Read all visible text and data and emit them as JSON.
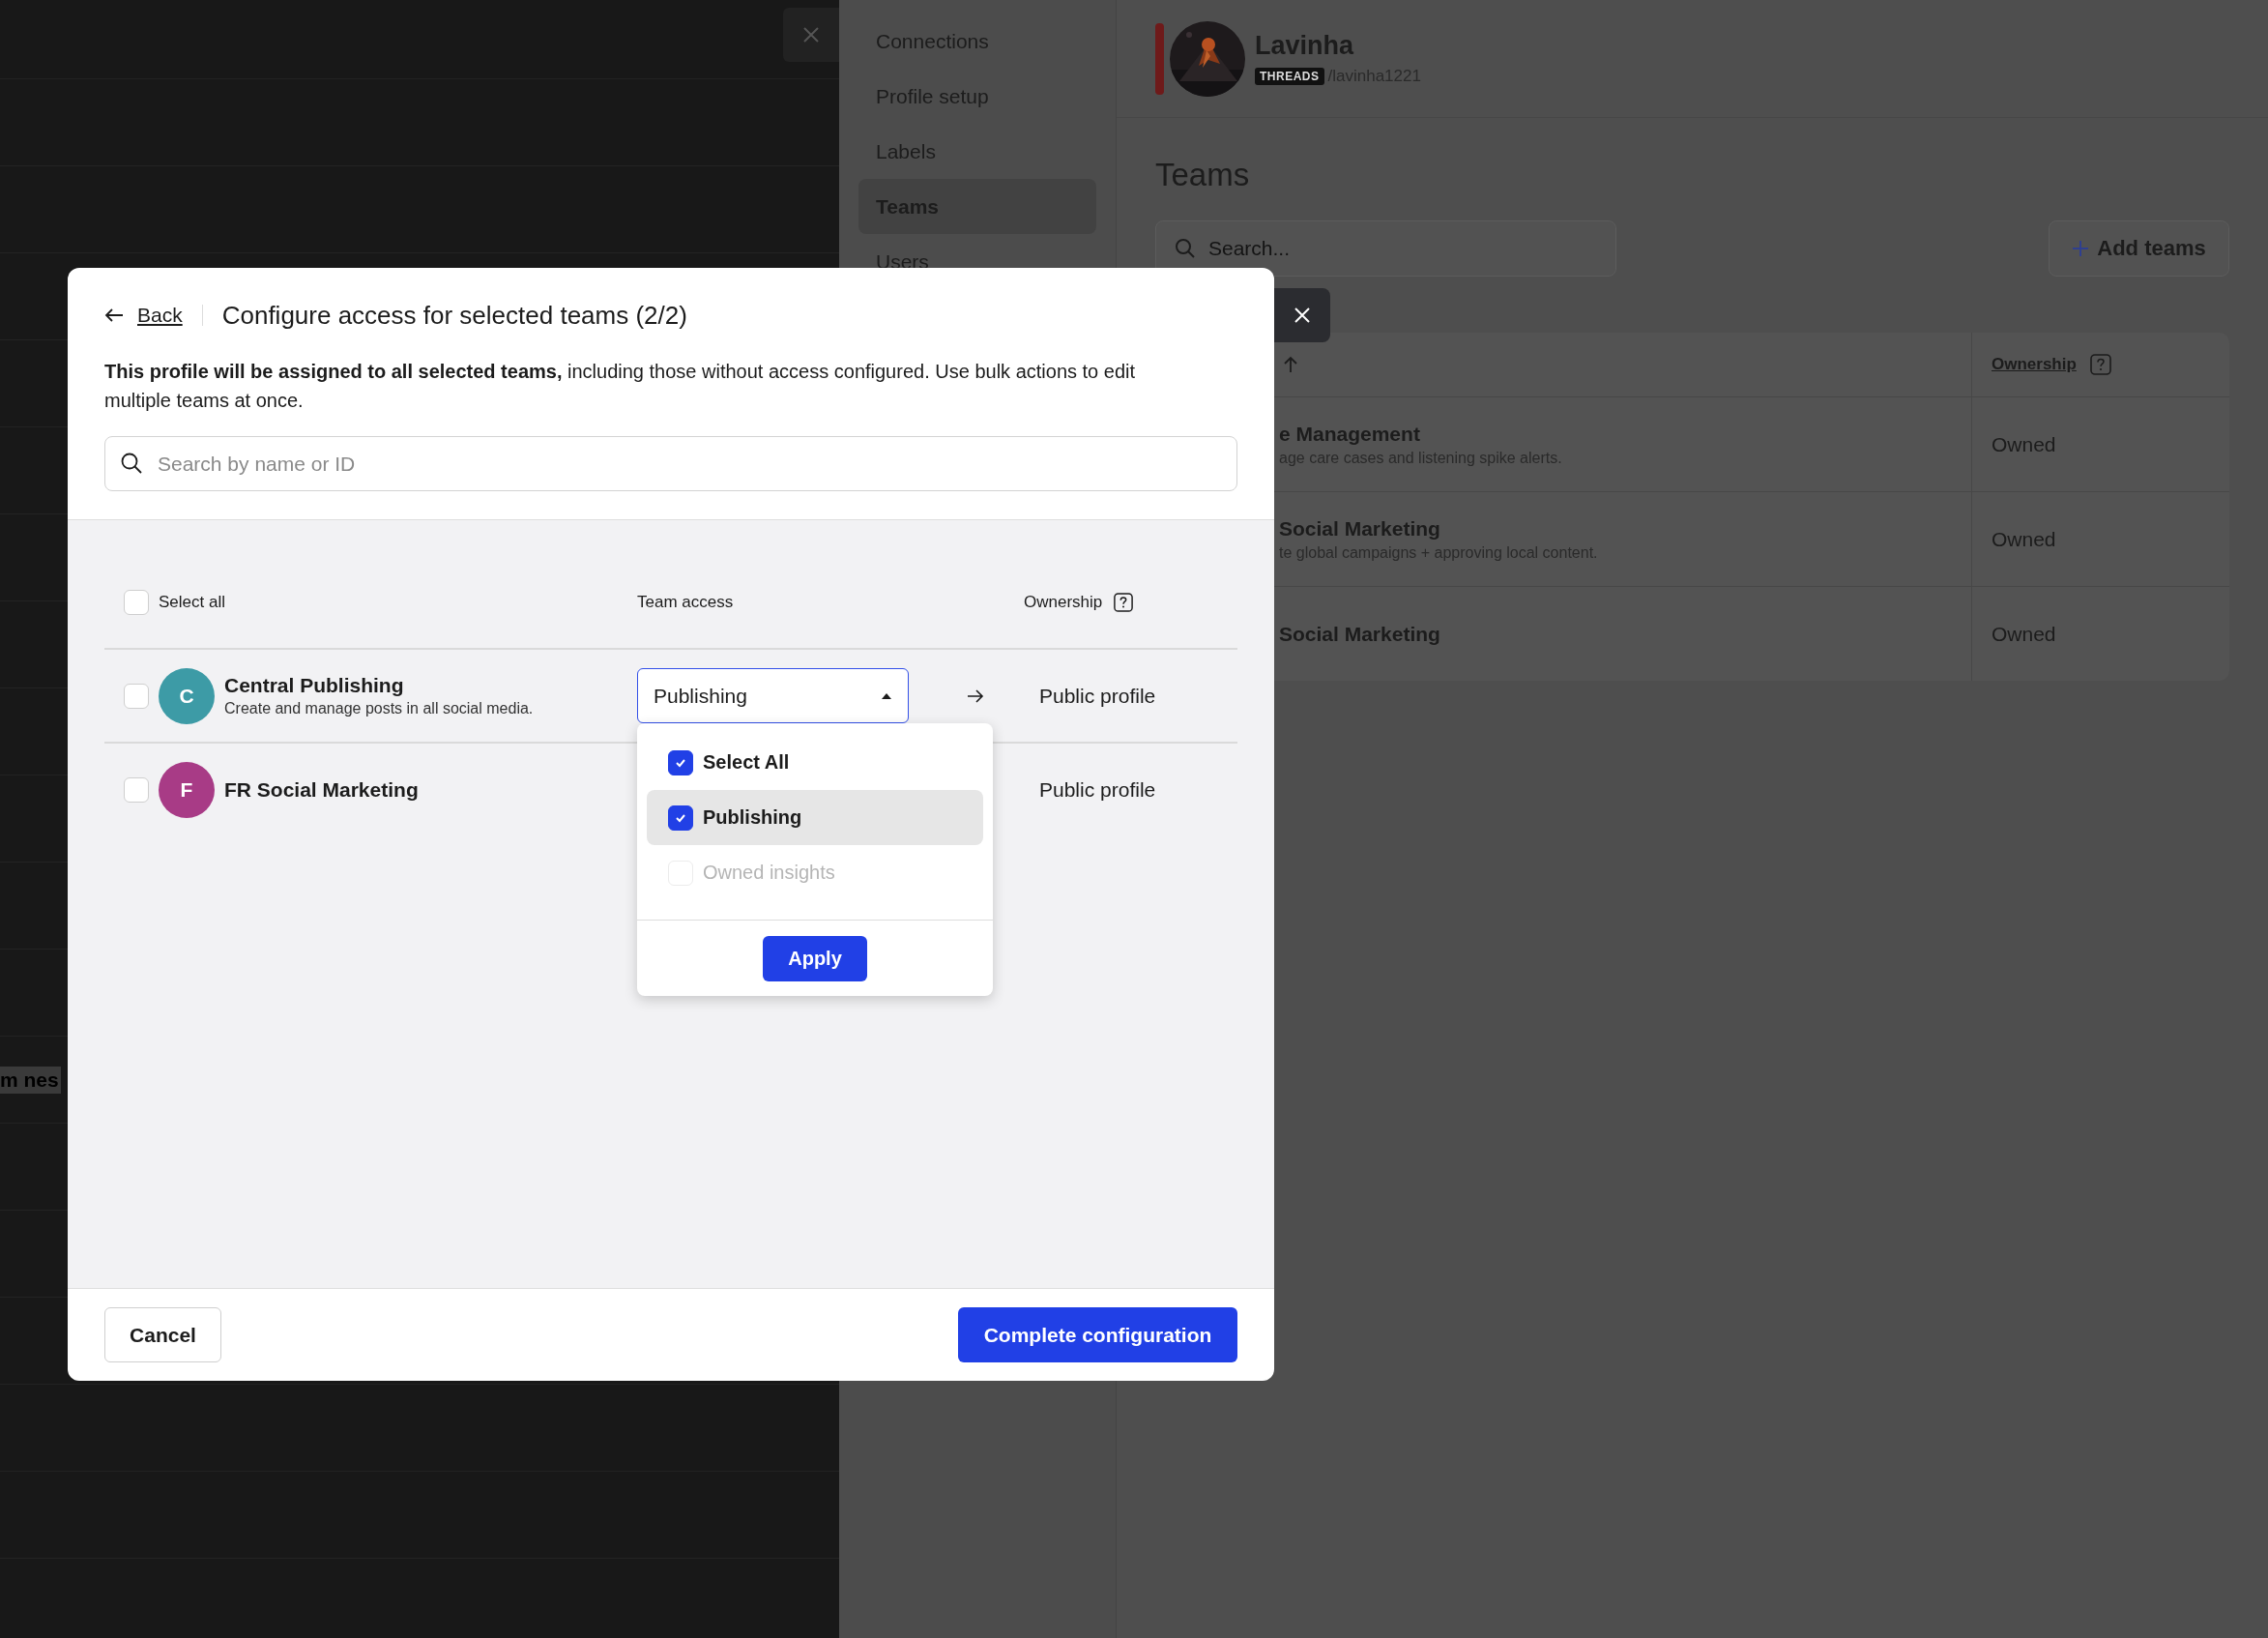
{
  "background_panel": {
    "partial_text": "m nes"
  },
  "sidebar": {
    "items": [
      {
        "label": "Connections",
        "selected": false
      },
      {
        "label": "Profile setup",
        "selected": false
      },
      {
        "label": "Labels",
        "selected": false
      },
      {
        "label": "Teams",
        "selected": true
      },
      {
        "label": "Users",
        "selected": false
      }
    ]
  },
  "profile": {
    "name": "Lavinha",
    "network_badge": "THREADS",
    "handle": "/lavinha1221"
  },
  "page": {
    "title": "Teams",
    "search": {
      "placeholder": "Search..."
    },
    "add_button": "Add teams",
    "table": {
      "columns": [
        {
          "label": "Ownership"
        }
      ],
      "rows": [
        {
          "name": "e Management",
          "description": "age care cases and listening spike alerts.",
          "ownership": "Owned"
        },
        {
          "name": "Social Marketing",
          "description": "te global campaigns + approving local content.",
          "ownership": "Owned"
        },
        {
          "name": "Social Marketing",
          "ownership": "Owned"
        }
      ]
    }
  },
  "modal": {
    "back": "Back",
    "title": "Configure access for selected teams (2/2)",
    "description": "**This profile will be assigned to all selected teams,** including those without access configured. Use bulk actions to edit multiple teams at once.",
    "search": {
      "placeholder": "Search by name or ID"
    },
    "select_all": {
      "label": "Select all",
      "checked": false
    },
    "columns": [
      "Team access",
      "Ownership"
    ],
    "teams": [
      {
        "initial": "C",
        "name": "Central Publishing",
        "description": "Create and manage posts in all social media.",
        "checked": false,
        "color": "#3d9ba6",
        "access": "Publishing",
        "ownership": "Public profile"
      },
      {
        "initial": "F",
        "name": "FR Social Marketing",
        "checked": false,
        "color": "#a83b86",
        "ownership": "Public profile"
      }
    ],
    "dropdown": {
      "expanded": true,
      "apply": "Apply",
      "options": [
        {
          "label": "Select All",
          "checked": true,
          "selected": false,
          "disabled": false
        },
        {
          "label": "Publishing",
          "checked": true,
          "selected": true,
          "disabled": false
        },
        {
          "label": "Owned insights",
          "checked": false,
          "selected": false,
          "disabled": true
        }
      ]
    },
    "cancel": "Cancel",
    "confirm": "Complete configuration"
  }
}
